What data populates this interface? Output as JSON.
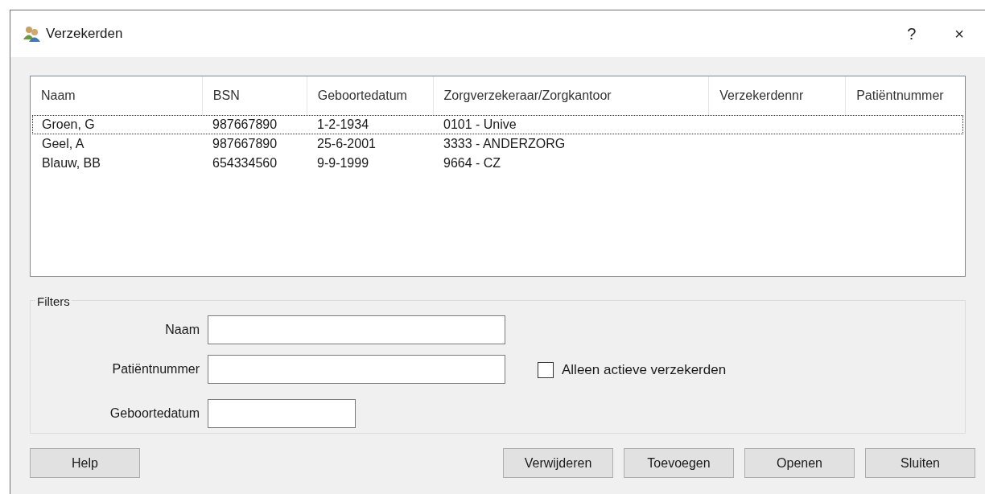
{
  "window": {
    "title": "Verzekerden",
    "buttons": [
      "?",
      "×"
    ]
  },
  "table": {
    "columns": [
      "Naam",
      "BSN",
      "Geboortedatum",
      "Zorgverzekeraar/Zorgkantoor",
      "Verzekerdennr",
      "Patiëntnummer"
    ],
    "rows": [
      {
        "cells": [
          "Groen, G",
          "987667890",
          "1-2-1934",
          "0101 - Unive"
        ],
        "selected": true
      },
      {
        "cells": [
          "Geel, A",
          "987667890",
          "25-6-2001",
          "3333 - ANDERZORG"
        ],
        "selected": false
      },
      {
        "cells": [
          "Blauw, BB",
          "654334560",
          "9-9-1999",
          "9664 - CZ"
        ],
        "selected": false
      }
    ]
  },
  "filters": {
    "title": "Filters",
    "fields": [
      {
        "label": "Naam",
        "kind": "long"
      },
      {
        "label": "Patiëntnummer",
        "kind": "long"
      },
      {
        "label": "Geboortedatum",
        "kind": "short"
      }
    ],
    "checkbox": {
      "label": "Alleen actieve verzekerden",
      "checked": false
    }
  },
  "buttons": {
    "left": [
      "Help"
    ],
    "right": [
      "Verwijderen",
      "Toevoegen",
      "Openen",
      "Sluiten"
    ]
  }
}
